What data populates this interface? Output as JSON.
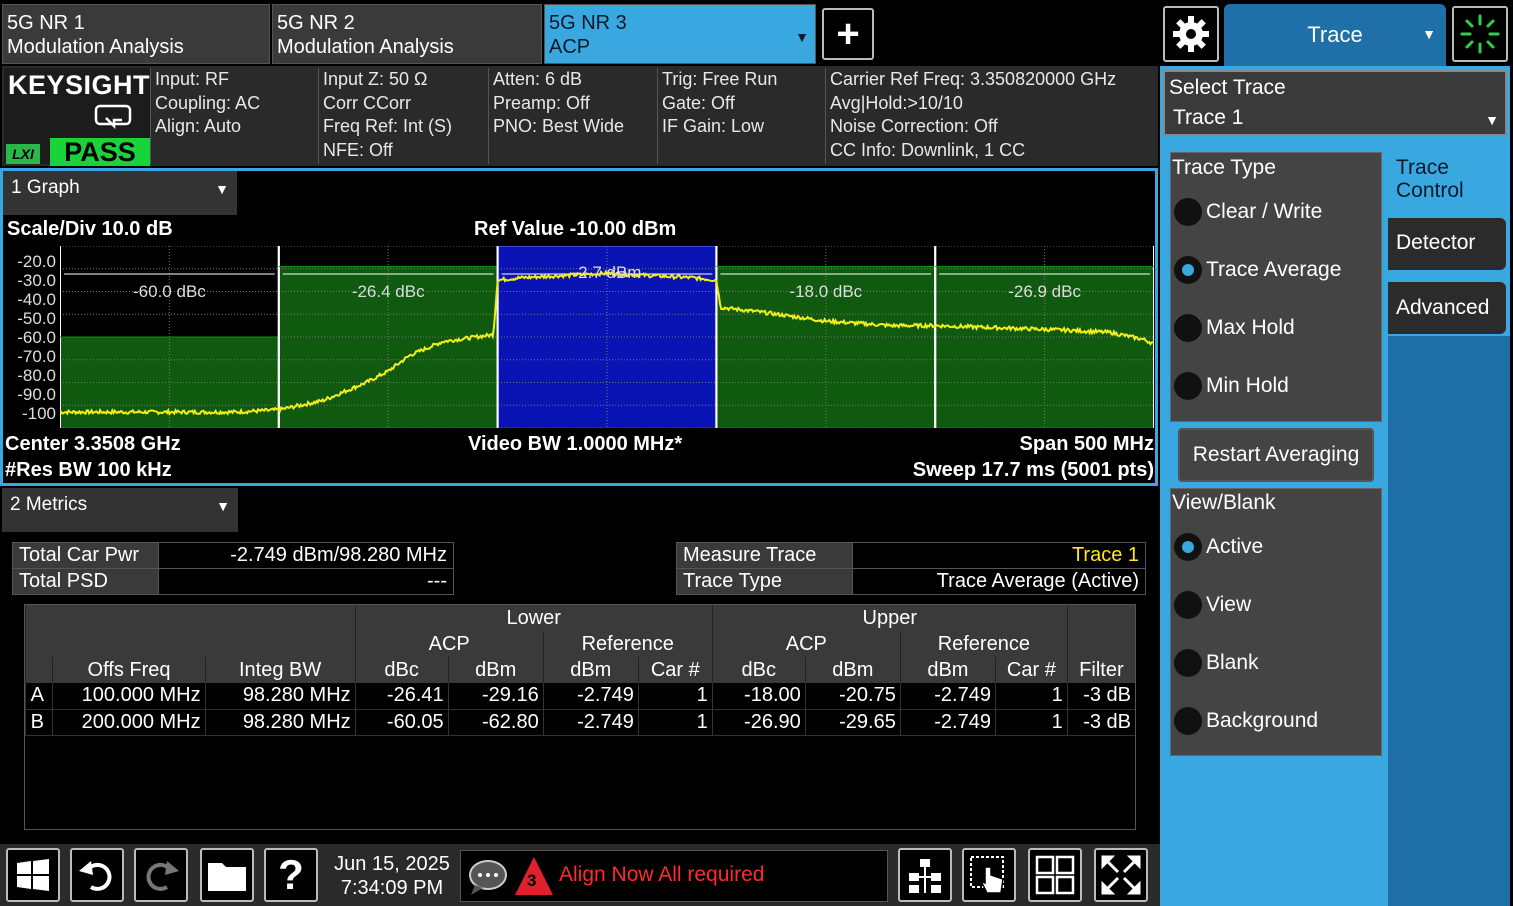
{
  "tabs": [
    {
      "line1": "5G NR 1",
      "line2": "Modulation Analysis"
    },
    {
      "line1": "5G NR 2",
      "line2": "Modulation Analysis"
    },
    {
      "line1": "5G NR 3",
      "line2": "ACP"
    }
  ],
  "menu_dropdown": "Trace",
  "brand": {
    "logo": "KEYSIGHT",
    "lxi": "LXI",
    "pass": "PASS"
  },
  "status": {
    "col1": [
      "Input: RF",
      "Coupling: AC",
      "Align: Auto"
    ],
    "col2": [
      "Input Z: 50 Ω",
      "Corr CCorr",
      "Freq Ref: Int (S)",
      "NFE: Off"
    ],
    "col3": [
      "Atten: 6 dB",
      "Preamp: Off",
      "PNO: Best Wide"
    ],
    "col4": [
      "Trig: Free Run",
      "Gate: Off",
      "IF Gain: Low"
    ],
    "col5": [
      "Carrier Ref Freq: 3.350820000 GHz",
      "Avg|Hold:>10/10",
      "Noise Correction: Off",
      "CC Info: Downlink, 1 CC"
    ]
  },
  "graph": {
    "window_title": "1 Graph",
    "scale_div": "Scale/Div 10.0 dB",
    "ref_value": "Ref Value -10.00 dBm",
    "center": "Center 3.3508 GHz",
    "res_bw": "#Res BW 100 kHz",
    "video_bw": "Video BW 1.0000 MHz*",
    "span": "Span 500 MHz",
    "sweep": "Sweep 17.7 ms (5001 pts)"
  },
  "chart_data": {
    "type": "line",
    "ylabel_ticks": [
      "-20.0",
      "-30.0",
      "-40.0",
      "-50.0",
      "-60.0",
      "-70.0",
      "-80.0",
      "-90.0",
      "-100"
    ],
    "ylim": [
      -100,
      -20
    ],
    "xlim": [
      -250,
      250
    ],
    "x_unit": "MHz offset",
    "segments": [
      {
        "label": "-60.0 dBc",
        "x0": -250,
        "x1": -150,
        "limit": -60
      },
      {
        "label": "-26.4 dBc",
        "x0": -150,
        "x1": -50,
        "limit": -29
      },
      {
        "label": "-2.7 dBm",
        "x0": -50,
        "x1": 50,
        "limit": -20,
        "main": true
      },
      {
        "label": "-18.0 dBc",
        "x0": 50,
        "x1": 150,
        "limit": -29
      },
      {
        "label": "-26.9 dBc",
        "x0": 150,
        "x1": 250,
        "limit": -29
      }
    ],
    "trace": {
      "x": [
        -250,
        -200,
        -170,
        -150,
        -130,
        -110,
        -100,
        -90,
        -75,
        -60,
        -52,
        -50,
        -40,
        -20,
        0,
        20,
        40,
        50,
        52,
        70,
        100,
        130,
        150,
        180,
        210,
        230,
        245,
        250
      ],
      "y": [
        -93,
        -93,
        -93,
        -92,
        -88,
        -80,
        -75,
        -68,
        -62,
        -60,
        -59,
        -35,
        -34,
        -33,
        -32,
        -33,
        -34,
        -35,
        -47,
        -49,
        -53,
        -55,
        -55,
        -56,
        -57,
        -58,
        -61,
        -63
      ]
    },
    "grid": true
  },
  "metrics": {
    "window_title": "2 Metrics",
    "total_car_pwr_label": "Total Car Pwr",
    "total_car_pwr_value": "-2.749 dBm/98.280 MHz",
    "total_psd_label": "Total PSD",
    "total_psd_value": "---",
    "measure_trace_label": "Measure Trace",
    "measure_trace_value": "Trace 1",
    "trace_type_label": "Trace Type",
    "trace_type_value": "Trace Average (Active)",
    "acp_header": {
      "lower": "Lower",
      "upper": "Upper",
      "acp": "ACP",
      "reference": "Reference",
      "cols": [
        "Offs Freq",
        "Integ BW",
        "dBc",
        "dBm",
        "dBm",
        "Car #",
        "dBc",
        "dBm",
        "dBm",
        "Car #",
        "Filter"
      ]
    },
    "acp_rows": [
      {
        "id": "A",
        "offs": "100.000 MHz",
        "integ": "98.280 MHz",
        "l_dbc": "-26.41",
        "l_dbm": "-29.16",
        "l_ref_dbm": "-2.749",
        "l_car": "1",
        "u_dbc": "-18.00",
        "u_dbm": "-20.75",
        "u_ref_dbm": "-2.749",
        "u_car": "1",
        "filter": "-3 dB"
      },
      {
        "id": "B",
        "offs": "200.000 MHz",
        "integ": "98.280 MHz",
        "l_dbc": "-60.05",
        "l_dbm": "-62.80",
        "l_ref_dbm": "-2.749",
        "l_car": "1",
        "u_dbc": "-26.90",
        "u_dbm": "-29.65",
        "u_ref_dbm": "-2.749",
        "u_car": "1",
        "filter": "-3 dB"
      }
    ]
  },
  "right_panel": {
    "select_trace_label": "Select Trace",
    "select_trace_value": "Trace 1",
    "trace_type_title": "Trace Type",
    "trace_types": [
      "Clear / Write",
      "Trace Average",
      "Max Hold",
      "Min Hold"
    ],
    "trace_type_selected": 1,
    "restart_averaging": "Restart Averaging",
    "view_blank_title": "View/Blank",
    "view_blank": [
      "Active",
      "View",
      "Blank",
      "Background"
    ],
    "view_blank_selected": 0,
    "side_tabs": [
      "Trace Control",
      "Detector",
      "Advanced"
    ]
  },
  "taskbar": {
    "date": "Jun 15, 2025",
    "time": "7:34:09 PM",
    "alert_count": "3",
    "message": "Align Now All required"
  }
}
